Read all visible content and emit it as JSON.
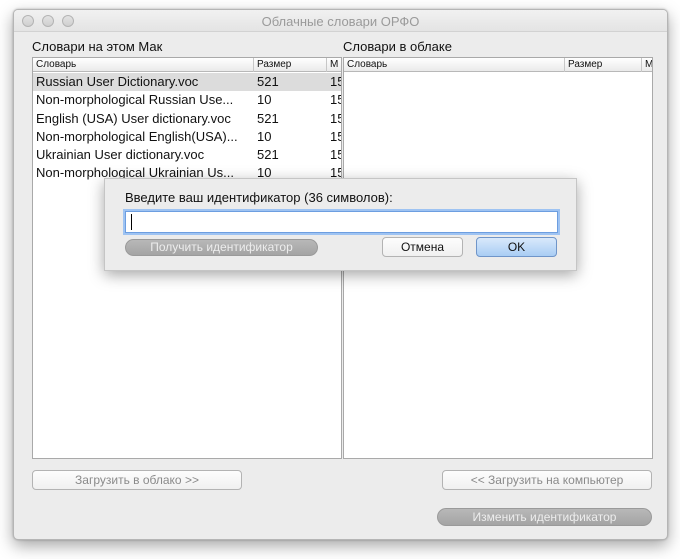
{
  "window": {
    "title": "Облачные словари ОРФО"
  },
  "left_panel": {
    "label": "Словари на этом Мак",
    "columns": [
      "Словарь",
      "Размер",
      "М"
    ],
    "rows": [
      {
        "name": "Russian User Dictionary.voc",
        "size": "521",
        "mod": "15",
        "selected": true
      },
      {
        "name": "Non-morphological Russian Use...",
        "size": "10",
        "mod": "15",
        "selected": false
      },
      {
        "name": "English (USA) User dictionary.voc",
        "size": "521",
        "mod": "15",
        "selected": false
      },
      {
        "name": "Non-morphological English(USA)...",
        "size": "10",
        "mod": "15",
        "selected": false
      },
      {
        "name": "Ukrainian User dictionary.voc",
        "size": "521",
        "mod": "15",
        "selected": false
      },
      {
        "name": "Non-morphological Ukrainian Us...",
        "size": "10",
        "mod": "15",
        "selected": false
      }
    ],
    "upload_button": "Загрузить в облако >>"
  },
  "right_panel": {
    "label": "Словари в облаке",
    "columns": [
      "Словарь",
      "Размер",
      "М"
    ],
    "download_button": "<< Загрузить на компьютер",
    "change_id_button": "Изменить идентификатор"
  },
  "dialog": {
    "prompt": "Введите ваш идентификатор (36 символов):",
    "input_value": "",
    "get_id_button": "Получить идентификатор",
    "cancel_button": "Отмена",
    "ok_button": "OK"
  },
  "colors": {
    "window_bg": "#ececec",
    "selection": "#dcdcdc",
    "focus_ring": "#9ec3f2",
    "default_button": "#a9cdf4"
  }
}
